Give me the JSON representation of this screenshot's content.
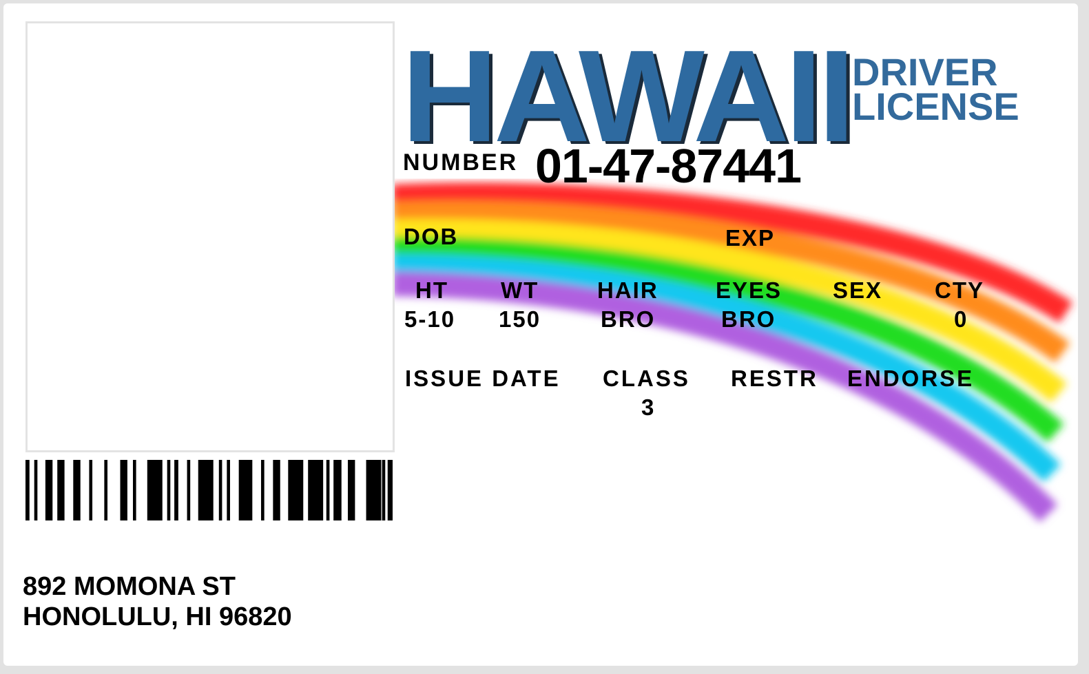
{
  "header": {
    "state": "HAWAII",
    "doc_line1": "DRIVER",
    "doc_line2": "LICENSE"
  },
  "number": {
    "label": "NUMBER",
    "value": "01-47-87441"
  },
  "fields": {
    "dob": {
      "label": "DOB",
      "value": ""
    },
    "exp": {
      "label": "EXP",
      "value": ""
    },
    "ht": {
      "label": "HT",
      "value": "5-10"
    },
    "wt": {
      "label": "WT",
      "value": "150"
    },
    "hair": {
      "label": "HAIR",
      "value": "BRO"
    },
    "eyes": {
      "label": "EYES",
      "value": "BRO"
    },
    "sex": {
      "label": "SEX",
      "value": ""
    },
    "cty": {
      "label": "CTY",
      "value": "0"
    },
    "issue_date": {
      "label": "ISSUE DATE",
      "value": ""
    },
    "class": {
      "label": "CLASS",
      "value": "3"
    },
    "restr": {
      "label": "RESTR",
      "value": ""
    },
    "endorse": {
      "label": "ENDORSE",
      "value": ""
    }
  },
  "address": {
    "line1": "892 MOMONA ST",
    "line2": "HONOLULU, HI 96820"
  },
  "colors": {
    "brand": "#2e6aa0",
    "rainbow": [
      "#ff2a2a",
      "#ff8c1a",
      "#ffe51a",
      "#22dd22",
      "#19c8f0",
      "#b060e0"
    ]
  }
}
